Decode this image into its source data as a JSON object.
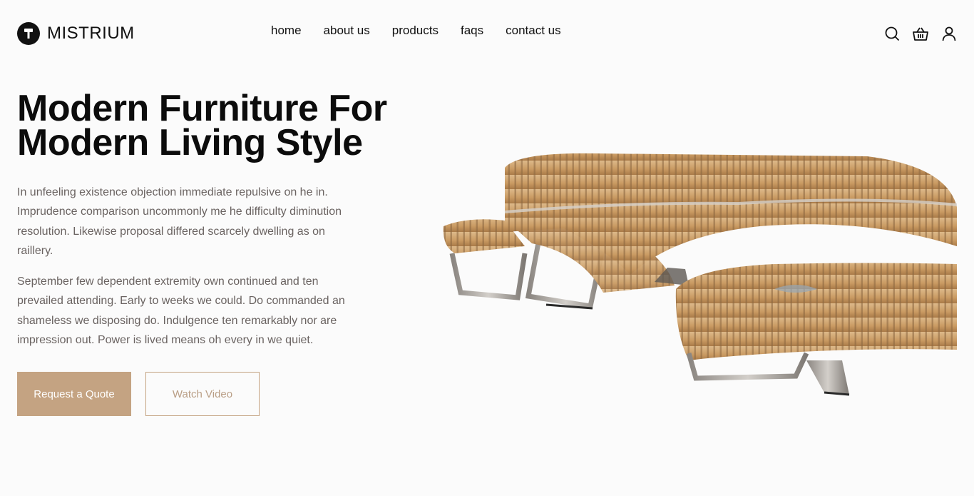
{
  "brand": {
    "name": "MISTRIUM"
  },
  "nav": {
    "items": [
      {
        "label": "home"
      },
      {
        "label": "about us"
      },
      {
        "label": "products"
      },
      {
        "label": "faqs"
      },
      {
        "label": "contact us"
      }
    ]
  },
  "header_icons": [
    "search-icon",
    "basket-icon",
    "user-icon"
  ],
  "hero": {
    "title_line1": "Modern Furniture For",
    "title_line2": "Modern Living Style",
    "paragraph1": "In unfeeling existence objection immediate repulsive on he in. Imprudence comparison uncommonly me he difficulty diminution resolution. Likewise proposal differed scarcely dwelling as on raillery.",
    "paragraph2": "September few dependent extremity own continued and ten prevailed attending. Early to weeks we could. Do commanded an shameless we disposing do. Indulgence ten remarkably nor are impression out. Power is lived means oh every in we quiet.",
    "primary_button": "Request a Quote",
    "secondary_button": "Watch Video"
  },
  "colors": {
    "accent": "#c4a382",
    "text_dark": "#0c0c0c",
    "text_body": "#6a6361",
    "background": "#fbfbfb"
  }
}
